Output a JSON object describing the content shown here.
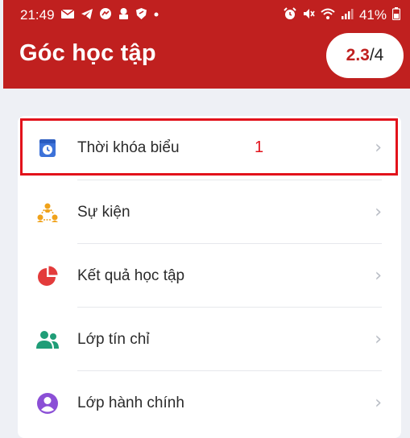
{
  "status_bar": {
    "time": "21:49",
    "battery": "41%",
    "left_icons": [
      "mail-icon",
      "telegram-icon",
      "messenger-icon",
      "game-icon",
      "shield-icon",
      "dot-icon"
    ],
    "right_icons": [
      "alarm-icon",
      "mute-icon",
      "wifi-icon",
      "signal-icon",
      "battery-icon"
    ]
  },
  "header": {
    "title": "Góc học tập",
    "progress_current": "2.3",
    "progress_total": "/4",
    "background_color": "#c0201f"
  },
  "menu": {
    "items": [
      {
        "label": "Thời khóa biểu",
        "icon": "calendar-clock-icon",
        "icon_color": "#3d72d9"
      },
      {
        "label": "Sự kiện",
        "icon": "event-people-icon",
        "icon_color": "#f0a21a"
      },
      {
        "label": "Kết quả học tập",
        "icon": "pie-chart-icon",
        "icon_color": "#e33b3b"
      },
      {
        "label": "Lớp tín chỉ",
        "icon": "group-icon",
        "icon_color": "#1f9d77"
      },
      {
        "label": "Lớp hành chính",
        "icon": "person-circle-icon",
        "icon_color": "#8b4fd6"
      }
    ]
  },
  "annotation": {
    "step": "1",
    "color": "#e2121b"
  }
}
